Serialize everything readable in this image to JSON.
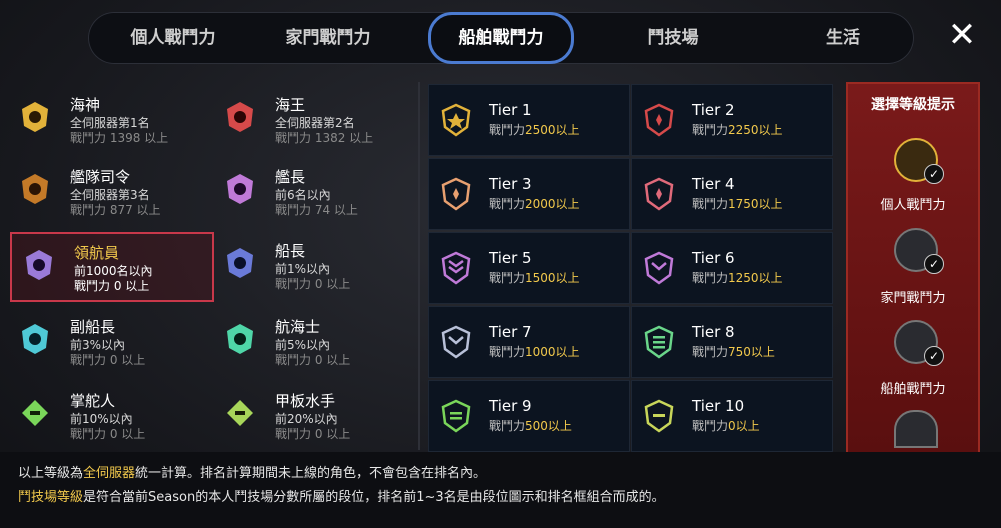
{
  "tabs": [
    "個人戰鬥力",
    "家門戰鬥力",
    "船舶戰鬥力",
    "鬥技場",
    "生活"
  ],
  "active_tab": "船舶戰鬥力",
  "ranks": [
    {
      "name": "海神",
      "cond": "全伺服器第1名",
      "power": "戰鬥力 1398 以上",
      "color": "#e2b23a"
    },
    {
      "name": "海王",
      "cond": "全伺服器第2名",
      "power": "戰鬥力 1382 以上",
      "color": "#d64a4a"
    },
    {
      "name": "艦隊司令",
      "cond": "全伺服器第3名",
      "power": "戰鬥力 877 以上",
      "color": "#c47a28"
    },
    {
      "name": "艦長",
      "cond": "前6名以內",
      "power": "戰鬥力 74 以上",
      "color": "#c07ad8"
    },
    {
      "name": "領航員",
      "cond": "前1000名以內",
      "power": "戰鬥力 0 以上",
      "color": "#9a7ad8"
    },
    {
      "name": "船長",
      "cond": "前1%以內",
      "power": "戰鬥力 0 以上",
      "color": "#6a7ad8"
    },
    {
      "name": "副船長",
      "cond": "前3%以內",
      "power": "戰鬥力 0 以上",
      "color": "#4fc9d6"
    },
    {
      "name": "航海士",
      "cond": "前5%以內",
      "power": "戰鬥力 0 以上",
      "color": "#4fd6a8"
    },
    {
      "name": "掌舵人",
      "cond": "前10%以內",
      "power": "戰鬥力 0 以上",
      "color": "#7ad65a"
    },
    {
      "name": "甲板水手",
      "cond": "前20%以內",
      "power": "戰鬥力 0 以上",
      "color": "#a8d65a"
    }
  ],
  "tier_label": "戰鬥力",
  "tiers": [
    {
      "name": "Tier 1",
      "value": "2500以上",
      "color": "#e2b23a"
    },
    {
      "name": "Tier 2",
      "value": "2250以上",
      "color": "#d64a4a"
    },
    {
      "name": "Tier 3",
      "value": "2000以上",
      "color": "#e8a070"
    },
    {
      "name": "Tier 4",
      "value": "1750以上",
      "color": "#e06a7a"
    },
    {
      "name": "Tier 5",
      "value": "1500以上",
      "color": "#c07ad8"
    },
    {
      "name": "Tier 6",
      "value": "1250以上",
      "color": "#c07ad8"
    },
    {
      "name": "Tier 7",
      "value": "1000以上",
      "color": "#b8c0d8"
    },
    {
      "name": "Tier 8",
      "value": "750以上",
      "color": "#6ad68a"
    },
    {
      "name": "Tier 9",
      "value": "500以上",
      "color": "#7ad65a"
    },
    {
      "name": "Tier 10",
      "value": "0以上",
      "color": "#c8d65a"
    }
  ],
  "side": {
    "title": "選擇等級提示",
    "options": [
      "個人戰鬥力",
      "家門戰鬥力",
      "船舶戰鬥力"
    ]
  },
  "footer": {
    "line1_pre": "以上等級為",
    "line1_hl": "全伺服器",
    "line1_post": "統一計算。排名計算期間未上線的角色，不會包含在排名內。",
    "line2_hl": "鬥技場等級",
    "line2_post": "是符合當前Season的本人鬥技場分數所屬的段位，排名前1~3名是由段位圖示和排名框組合而成的。"
  }
}
